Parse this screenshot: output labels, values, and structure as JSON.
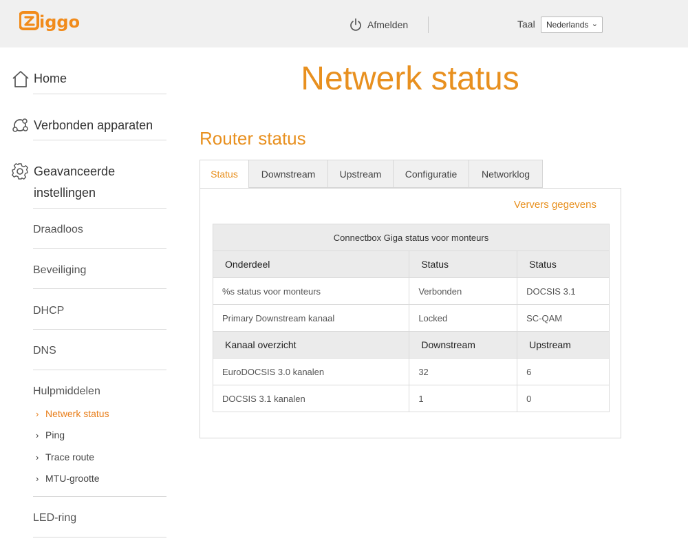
{
  "header": {
    "logo_text": "ziggo",
    "logout_label": "Afmelden",
    "language_label": "Taal",
    "language_selected": "Nederlands"
  },
  "sidebar": {
    "home": "Home",
    "connected_devices": "Verbonden apparaten",
    "advanced_line1": "Geavanceerde",
    "advanced_line2": "instellingen",
    "wireless": "Draadloos",
    "security": "Beveiliging",
    "dhcp": "DHCP",
    "dns": "DNS",
    "tools": "Hulpmiddelen",
    "tools_items": [
      "Netwerk status",
      "Ping",
      "Trace route",
      "MTU-grootte"
    ],
    "led_ring": "LED-ring"
  },
  "main": {
    "page_title": "Netwerk status",
    "section_title": "Router status",
    "tabs": [
      "Status",
      "Downstream",
      "Upstream",
      "Configuratie",
      "Networklog"
    ],
    "active_tab": "Status",
    "refresh_label": "Ververs gegevens",
    "table": {
      "caption": "Connectbox Giga status voor monteurs",
      "header1": [
        "Onderdeel",
        "Status",
        "Status"
      ],
      "rows1": [
        [
          "%s status voor monteurs",
          "Verbonden",
          "DOCSIS 3.1"
        ],
        [
          "Primary Downstream kanaal",
          "Locked",
          "SC-QAM"
        ]
      ],
      "header2": [
        "Kanaal overzicht",
        "Downstream",
        "Upstream"
      ],
      "rows2": [
        [
          "EuroDOCSIS 3.0 kanalen",
          "32",
          "6"
        ],
        [
          "DOCSIS 3.1 kanalen",
          "1",
          "0"
        ]
      ]
    }
  },
  "colors": {
    "accent": "#e8901f",
    "topbar_bg": "#f0f0f0",
    "table_header_bg": "#ebebeb"
  }
}
